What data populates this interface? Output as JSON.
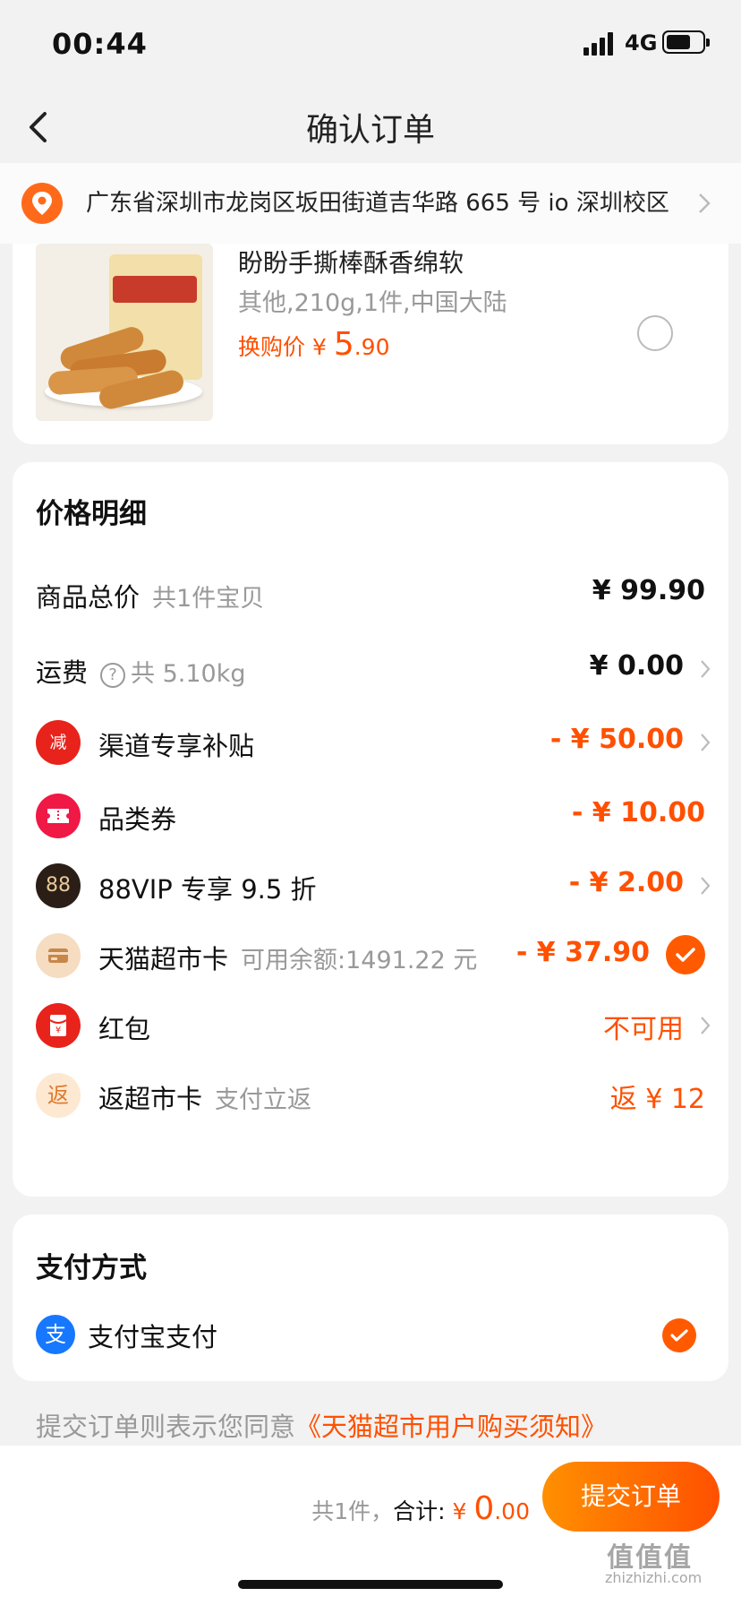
{
  "status_bar": {
    "time": "00:44",
    "network": "4G"
  },
  "nav": {
    "title": "确认订单"
  },
  "address": {
    "text": "广东省深圳市龙岗区坂田街道吉华路 665 号 io 深圳校区"
  },
  "product": {
    "title": "盼盼手撕棒酥香绵软",
    "spec": "其他,210g,1件,中国大陆",
    "swap_label": "换购价 ¥ ",
    "price_big": "5",
    "price_small": ".90"
  },
  "price_detail": {
    "title": "价格明细",
    "rows": [
      {
        "label": "商品总价",
        "sub": "共1件宝贝",
        "value": "¥ 99.90"
      },
      {
        "label": "运费",
        "help": "?",
        "sub": "共 5.10kg",
        "value": "¥ 0.00"
      },
      {
        "icon_text": "减",
        "label": "渠道专享补贴",
        "value": "- ¥ 50.00"
      },
      {
        "label": "品类券",
        "value": "- ¥ 10.00"
      },
      {
        "icon_text": "88",
        "label": "88VIP 专享 9.5 折",
        "value": "- ¥ 2.00"
      },
      {
        "label": "天猫超市卡",
        "sub": "可用余额:1491.22 元",
        "value": "- ¥ 37.90"
      },
      {
        "icon_text": "¥",
        "label": "红包",
        "value": "不可用"
      },
      {
        "icon_text": "返",
        "label": "返超市卡",
        "sub": "支付立返",
        "value": "返 ¥ 12"
      }
    ]
  },
  "payment": {
    "title": "支付方式",
    "method_icon": "支",
    "method": "支付宝支付"
  },
  "agreement": {
    "prefix": "提交订单则表示您同意",
    "link": "《天猫超市用户购买须知》"
  },
  "footer": {
    "count": "共1件，",
    "total_label": "合计: ",
    "currency": "¥ ",
    "total_big": "0",
    "total_small": ".00",
    "submit": "提交订单"
  },
  "watermark": {
    "main": "值值值",
    "sub": "zhizhizhi.com"
  },
  "colors": {
    "accent": "#ff5000",
    "red_icon": "#e8231c",
    "alipay": "#1677ff"
  }
}
